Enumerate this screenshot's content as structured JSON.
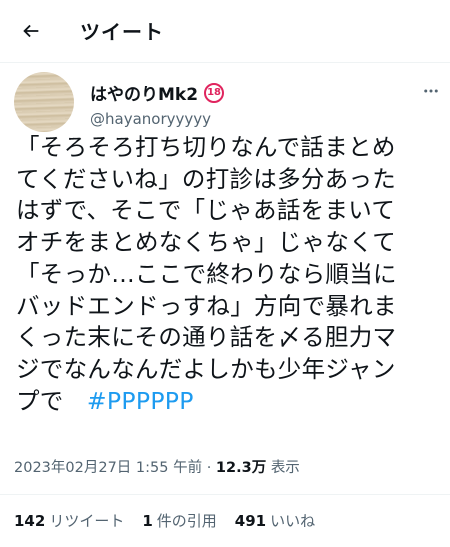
{
  "header": {
    "back_icon": "arrow-left-icon",
    "title": "ツイート"
  },
  "tweet": {
    "author": {
      "display_name": "はやのりMk2",
      "age_badge": "18",
      "handle": "@hayanoryyyyy"
    },
    "more_icon": "dots-icon",
    "text_lines": [
      "「そろそろ打ち切りなんで話まとめ",
      "てくださいね」の打診は多分あった",
      "はずで、そこで「じゃあ話をまいて",
      "オチをまとめなくちゃ」じゃなくて",
      "「そっか…ここで終わりなら順当に",
      "バッドエンドっすね」方向で暴れま",
      "くった末にその通り話を〆る胆力マ",
      "ジでなんなんだよしかも少年ジャン",
      "プで"
    ],
    "hashtag": "#PPPPPP",
    "timestamp": "2023年02月27日 1:55 午前",
    "separator": "·",
    "views_count": "12.3万",
    "views_label": "表示"
  },
  "stats": {
    "retweets_count": "142",
    "retweets_label": "リツイート",
    "quotes_count": "1",
    "quotes_label": "件の引用",
    "likes_count": "491",
    "likes_label": "いいね"
  },
  "colors": {
    "text": "#0f1419",
    "secondary": "#536471",
    "link": "#1d9bf0",
    "badge": "#e0245e"
  }
}
